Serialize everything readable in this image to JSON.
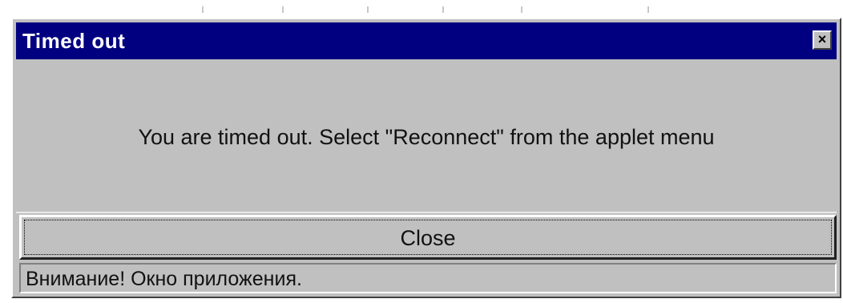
{
  "dialog": {
    "title": "Timed out",
    "close_icon": "close-icon",
    "close_glyph": "×",
    "message": "You are timed out. Select \"Reconnect\" from the applet menu",
    "close_button_label": "Close",
    "status_text": "Внимание! Окно приложения."
  },
  "colors": {
    "titlebar": "#000080",
    "face": "#c0c0c0",
    "title_text": "#ffffff"
  }
}
